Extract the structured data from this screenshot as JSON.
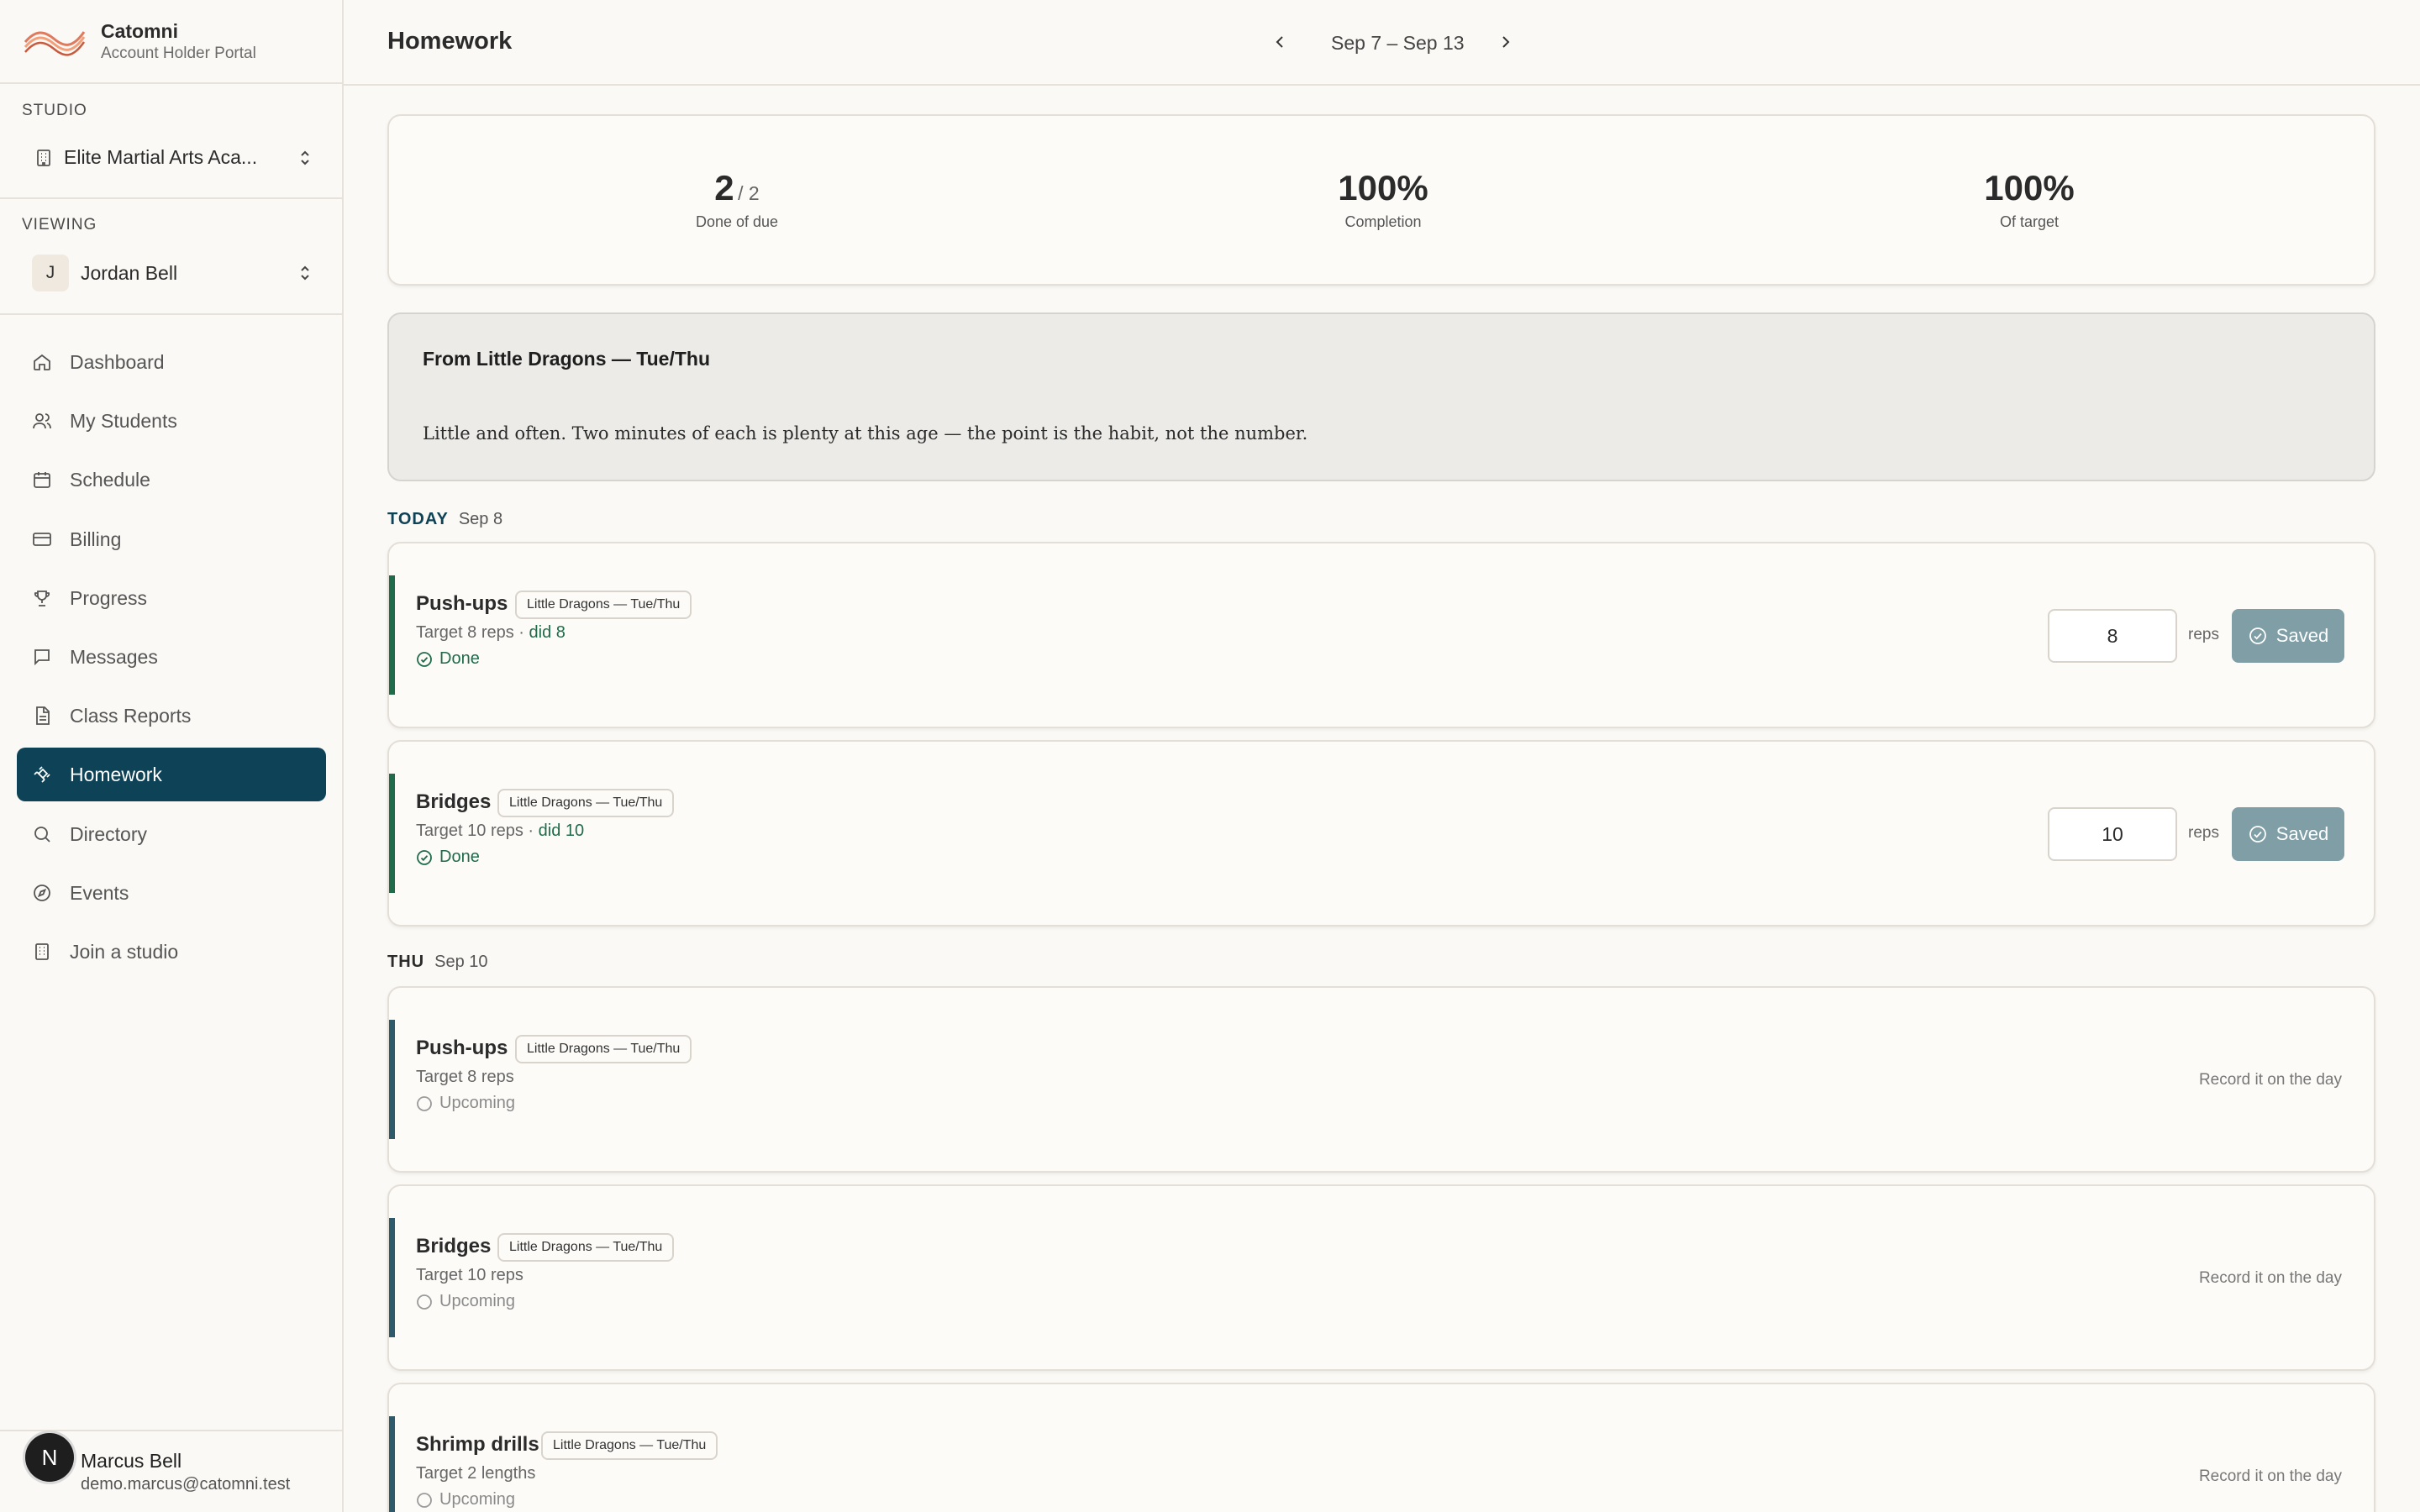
{
  "brand": {
    "name": "Catomni",
    "subtitle": "Account Holder Portal"
  },
  "studio": {
    "label": "STUDIO",
    "value": "Elite Martial Arts Aca..."
  },
  "viewing": {
    "label": "VIEWING",
    "initial": "J",
    "value": "Jordan Bell"
  },
  "nav": {
    "items": [
      {
        "label": "Dashboard",
        "icon": "home-icon"
      },
      {
        "label": "My Students",
        "icon": "users-icon"
      },
      {
        "label": "Schedule",
        "icon": "calendar-icon"
      },
      {
        "label": "Billing",
        "icon": "credit-card-icon"
      },
      {
        "label": "Progress",
        "icon": "trophy-icon"
      },
      {
        "label": "Messages",
        "icon": "message-icon"
      },
      {
        "label": "Class Reports",
        "icon": "document-icon"
      },
      {
        "label": "Homework",
        "icon": "dumbbell-icon",
        "active": true
      },
      {
        "label": "Directory",
        "icon": "search-icon"
      },
      {
        "label": "Events",
        "icon": "compass-icon"
      },
      {
        "label": "Join a studio",
        "icon": "building-icon"
      }
    ]
  },
  "user": {
    "initial": "N",
    "name": "Marcus Bell",
    "email": "demo.marcus@catomni.test"
  },
  "header": {
    "title": "Homework",
    "week": "Sep 7 – Sep 13"
  },
  "stats": [
    {
      "value": "2",
      "fraction": "/ 2",
      "caption": "Done of due"
    },
    {
      "value": "100%",
      "caption": "Completion"
    },
    {
      "value": "100%",
      "caption": "Of target"
    }
  ],
  "note": {
    "title": "From Little Dragons — Tue/Thu",
    "body": "Little and often. Two minutes of each is plenty at this age — the point is the habit, not the number."
  },
  "days": [
    {
      "name": "TODAY",
      "date": "Sep 8",
      "color": "#0e4256",
      "items": [
        {
          "name": "Push-ups",
          "tag": "Little Dragons — Tue/Thu",
          "target": "Target 8 reps",
          "did": "did 8",
          "status": "Done",
          "reps": "8",
          "unit": "reps",
          "button": "Saved"
        },
        {
          "name": "Bridges",
          "tag": "Little Dragons — Tue/Thu",
          "target": "Target 10 reps",
          "did": "did 10",
          "status": "Done",
          "reps": "10",
          "unit": "reps",
          "button": "Saved"
        }
      ]
    },
    {
      "name": "THU",
      "date": "Sep 10",
      "color": "#2b2b2b",
      "items": [
        {
          "name": "Push-ups",
          "tag": "Little Dragons — Tue/Thu",
          "target": "Target 8 reps",
          "status": "Upcoming",
          "record": "Record it on the day"
        },
        {
          "name": "Bridges",
          "tag": "Little Dragons — Tue/Thu",
          "target": "Target 10 reps",
          "status": "Upcoming",
          "record": "Record it on the day"
        },
        {
          "name": "Shrimp drills",
          "tag": "Little Dragons — Tue/Thu",
          "target": "Target 2 lengths",
          "status": "Upcoming",
          "record": "Record it on the day"
        }
      ]
    }
  ],
  "colors": {
    "accent": "#0e4256",
    "done": "#1f6b4a",
    "upcomingBar": "#2e5a6b",
    "doneBar": "#1f6b4a",
    "savedButton": "#7f9ea6"
  }
}
